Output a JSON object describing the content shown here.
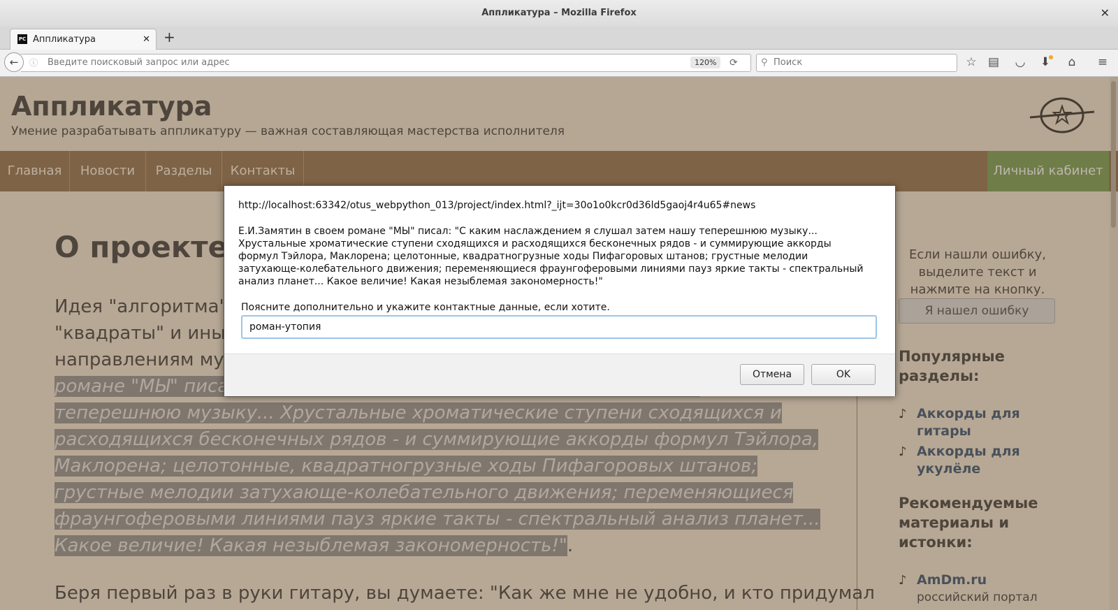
{
  "window": {
    "title": "Аппликатура – Mozilla Firefox"
  },
  "browser": {
    "tab_title": "Аппликатура",
    "url_placeholder": "Введите поисковый запрос или адрес",
    "zoom": "120%",
    "search_placeholder": "Поиск"
  },
  "site": {
    "title": "Аппликатура",
    "tagline": "Умение разрабатывать аппликатуру — важная составляющая мастерства исполнителя",
    "nav": [
      "Главная",
      "Новости",
      "Разделы",
      "Контакты"
    ],
    "cabinet": "Личный кабинет"
  },
  "article": {
    "heading": "О проекте",
    "p1_visible": "Идея \"алгоритма\" м",
    "p1_line2": "\"квадраты\" и иные",
    "p1_line3": "направлениям музы",
    "p1_highlighted": "романе \"МЫ\" писал: \"С каким наслаждением я слушал затем нашу теперешнюю музыку... Хрустальные хроматические ступени сходящихся и расходящихся бесконечных рядов - и суммирующие аккорды формул Тэйлора, Маклорена; целотонные, квадратногрузные ходы Пифагоровых штанов; грустные мелодии затухающе-колебательного движения; переменяющиеся фраунгоферовыми линиями пауз яркие такты - спектральный анализ планет... Какое величие! Какая незыблемая закономерность!\"",
    "p1_end": ".",
    "p2": "Беря первый раз в руки гитару, вы думаете: \"Как же мне не удобно, и кто придумал"
  },
  "sidebar": {
    "report_text": "Если нашли ошибку, выделите текст и нажмите на кнопку.",
    "report_button": "Я нашел ошибку",
    "popular_heading": "Популярные разделы:",
    "popular_links": [
      "Аккорды для гитары",
      "Аккорды для укулёле"
    ],
    "recommended_heading": "Рекомендуемые материалы и истонки:",
    "recommended_link": "AmDm.ru",
    "recommended_desc": "российский портал"
  },
  "dialog": {
    "origin": "http://localhost:63342/otus_webpython_013/project/index.html?_ijt=30o1o0kcr0d36ld5gaoj4r4u65#news",
    "message": " Е.И.Замятин в своем романе \"МЫ\" писал: \"С каким наслаждением я слушал затем нашу теперешнюю музыку... Хрустальные хроматические ступени сходящихся и расходящихся бесконечных рядов - и суммирующие аккорды формул Тэйлора, Маклорена; целотонные, квадратногрузные ходы Пифагоровых штанов; грустные мелодии затухающе-колебательного движения; переменяющиеся фраунгоферовыми линиями пауз яркие такты - спектральный анализ планет... Какое величие! Какая незыблемая закономерность!\"",
    "prompt": "Поясните дополнительно и укажите контактные данные, если хотите.",
    "input_value": "роман-утопия",
    "cancel": "Отмена",
    "ok": "OK"
  }
}
